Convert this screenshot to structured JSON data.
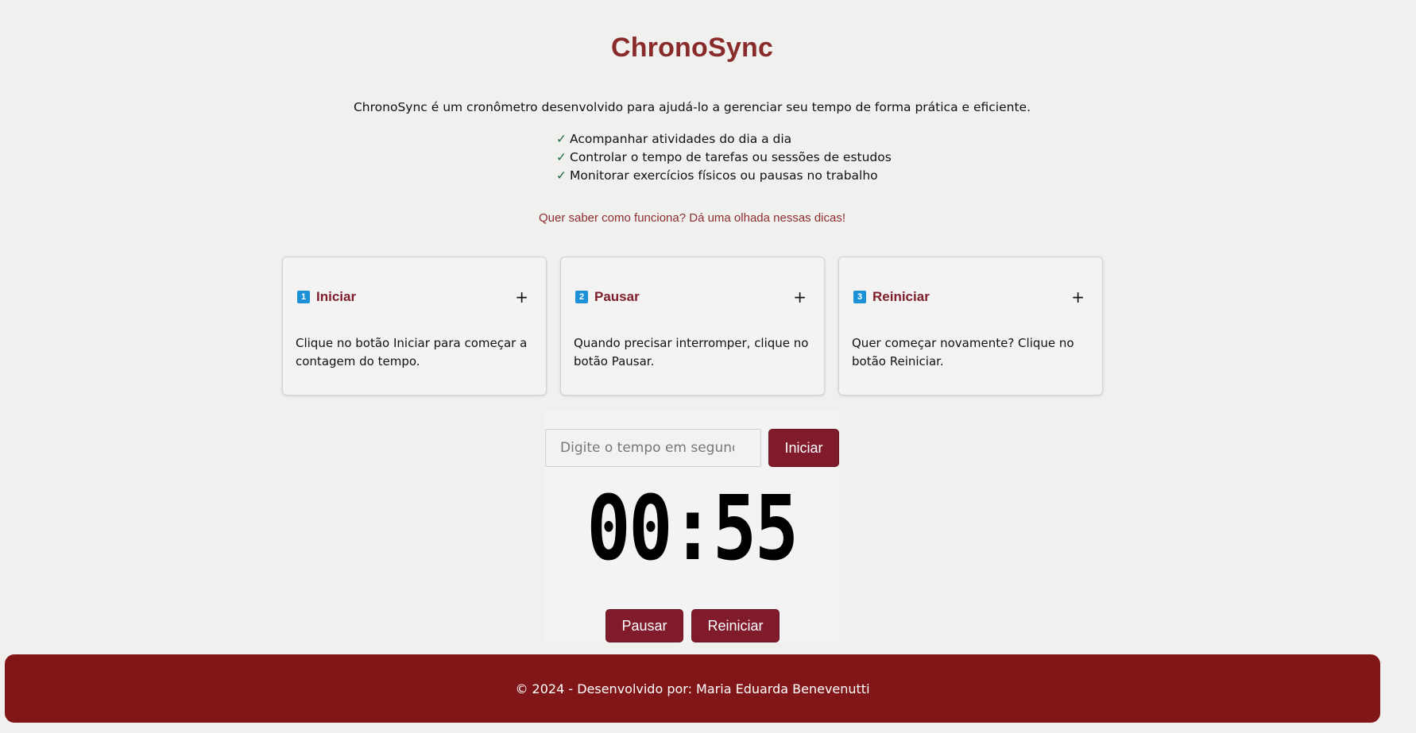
{
  "app": {
    "title": "ChronoSync",
    "description": "ChronoSync é um cronômetro desenvolvido para ajudá-lo a gerenciar seu tempo de forma prática e eficiente."
  },
  "features": [
    {
      "check": "✓",
      "text": "Acompanhar atividades do dia a dia"
    },
    {
      "check": "✓",
      "text": "Controlar o tempo de tarefas ou sessões de estudos"
    },
    {
      "check": "✓",
      "text": "Monitorar exercícios físicos ou pausas no trabalho"
    }
  ],
  "hint": "Quer saber como funciona? Dá uma olhada nessas dicas!",
  "cards": [
    {
      "number": "1",
      "title": "Iniciar",
      "toggle": "+",
      "body": "Clique no botão Iniciar para começar a contagem do tempo."
    },
    {
      "number": "2",
      "title": "Pausar",
      "toggle": "+",
      "body": "Quando precisar interromper, clique no botão Pausar."
    },
    {
      "number": "3",
      "title": "Reiniciar",
      "toggle": "+",
      "body": "Quer começar novamente? Clique no botão Reiniciar."
    }
  ],
  "timer": {
    "input_value": "",
    "input_placeholder": "Digite o tempo em segundos",
    "start_label": "Iniciar",
    "display": "00:55",
    "pause_label": "Pausar",
    "reset_label": "Reiniciar"
  },
  "footer": {
    "text": "© 2024 - Desenvolvido por: Maria Eduarda Benevenutti"
  },
  "colors": {
    "brand": "#811618",
    "button": "#7f1b2b",
    "title": "#8a2b2b",
    "badge": "#1d91d8",
    "check": "#1f6e3c",
    "background": "#f0f0ef"
  },
  "icons": {
    "check": "check-icon",
    "expand": "plus-icon"
  }
}
